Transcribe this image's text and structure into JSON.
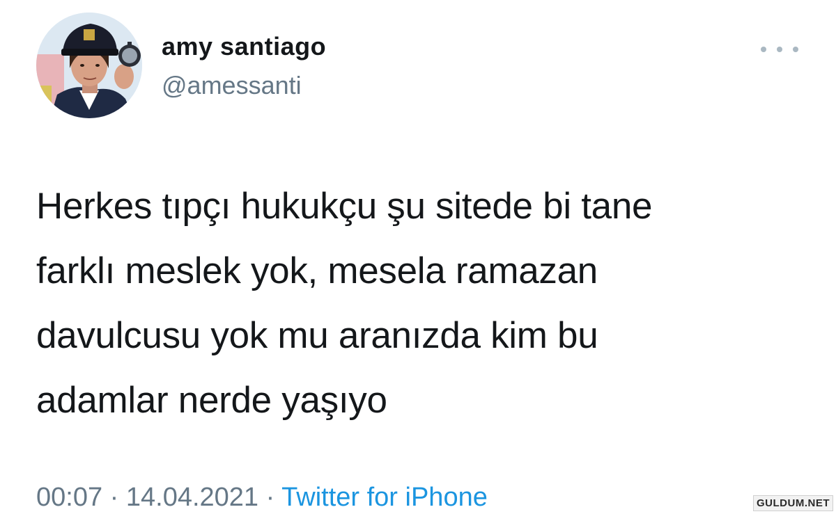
{
  "user": {
    "display_name": "amy santiago",
    "handle": "@amessanti",
    "avatar_icon": "profile-photo-police-cap"
  },
  "more_icon": "more-horizontal-icon",
  "tweet": {
    "lines": [
      "Herkes tıpçı hukukçu şu sitede bi tane",
      "farklı meslek yok, mesela ramazan",
      "davulcusu yok mu aranızda kim bu",
      "adamlar nerde yaşıyo"
    ]
  },
  "meta": {
    "time": "00:07",
    "separator": "·",
    "date": "14.04.2021",
    "source": "Twitter for iPhone"
  },
  "watermark": "GULDUM.NET",
  "colors": {
    "text": "#14171a",
    "secondary": "#657786",
    "link": "#1b95e0",
    "background": "#ffffff"
  }
}
